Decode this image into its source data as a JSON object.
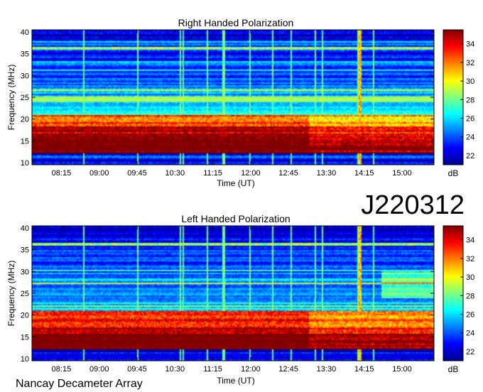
{
  "header": {
    "code": "J220312"
  },
  "footer": {
    "observatory": "Nancay Decameter Array"
  },
  "colorbar": {
    "unit": "dB",
    "range": [
      21,
      35.5
    ],
    "ticks": [
      "22",
      "24",
      "26",
      "28",
      "30",
      "32",
      "34"
    ],
    "tick_values": [
      22,
      24,
      26,
      28,
      30,
      32,
      34
    ],
    "colormap": [
      "#00008f",
      "#0000ff",
      "#0080ff",
      "#00ffff",
      "#80ff80",
      "#ffff00",
      "#ff8000",
      "#ff0000",
      "#800000"
    ]
  },
  "chart_data": [
    {
      "type": "heatmap",
      "title": "Right Handed Polarization",
      "xlabel": "Time (UT)",
      "ylabel": "Frequency (MHz)",
      "x_ticks": [
        "08:15",
        "09:00",
        "09:45",
        "10:30",
        "11:15",
        "12:00",
        "12:45",
        "13:30",
        "14:15",
        "15:00"
      ],
      "x_tick_minutes": [
        495,
        540,
        585,
        630,
        675,
        720,
        765,
        810,
        855,
        900
      ],
      "xlim_minutes": [
        460,
        938
      ],
      "y_ticks": [
        "10",
        "15",
        "20",
        "25",
        "30",
        "35",
        "40"
      ],
      "y_tick_values": [
        10,
        15,
        20,
        25,
        30,
        35,
        40
      ],
      "ylim": [
        9.5,
        40.5
      ],
      "bursts_minutes": [
        521,
        586,
        637,
        640,
        668,
        688,
        720,
        746,
        768,
        797,
        805,
        848,
        850,
        866
      ],
      "strong_burst_minutes": 850
    },
    {
      "type": "heatmap",
      "title": "Left Handed Polarization",
      "xlabel": "Time (UT)",
      "ylabel": "Frequency (MHz)",
      "x_ticks": [
        "08:15",
        "09:00",
        "09:45",
        "10:30",
        "11:15",
        "12:00",
        "12:45",
        "13:30",
        "14:15",
        "15:00"
      ],
      "x_tick_minutes": [
        495,
        540,
        585,
        630,
        675,
        720,
        765,
        810,
        855,
        900
      ],
      "xlim_minutes": [
        460,
        938
      ],
      "y_ticks": [
        "10",
        "15",
        "20",
        "25",
        "30",
        "35",
        "40"
      ],
      "y_tick_values": [
        10,
        15,
        20,
        25,
        30,
        35,
        40
      ],
      "ylim": [
        9.5,
        40.5
      ],
      "bursts_minutes": [
        521,
        586,
        637,
        640,
        668,
        688,
        720,
        746,
        768,
        797,
        805,
        848,
        850,
        866
      ],
      "strong_burst_minutes": 850
    }
  ]
}
